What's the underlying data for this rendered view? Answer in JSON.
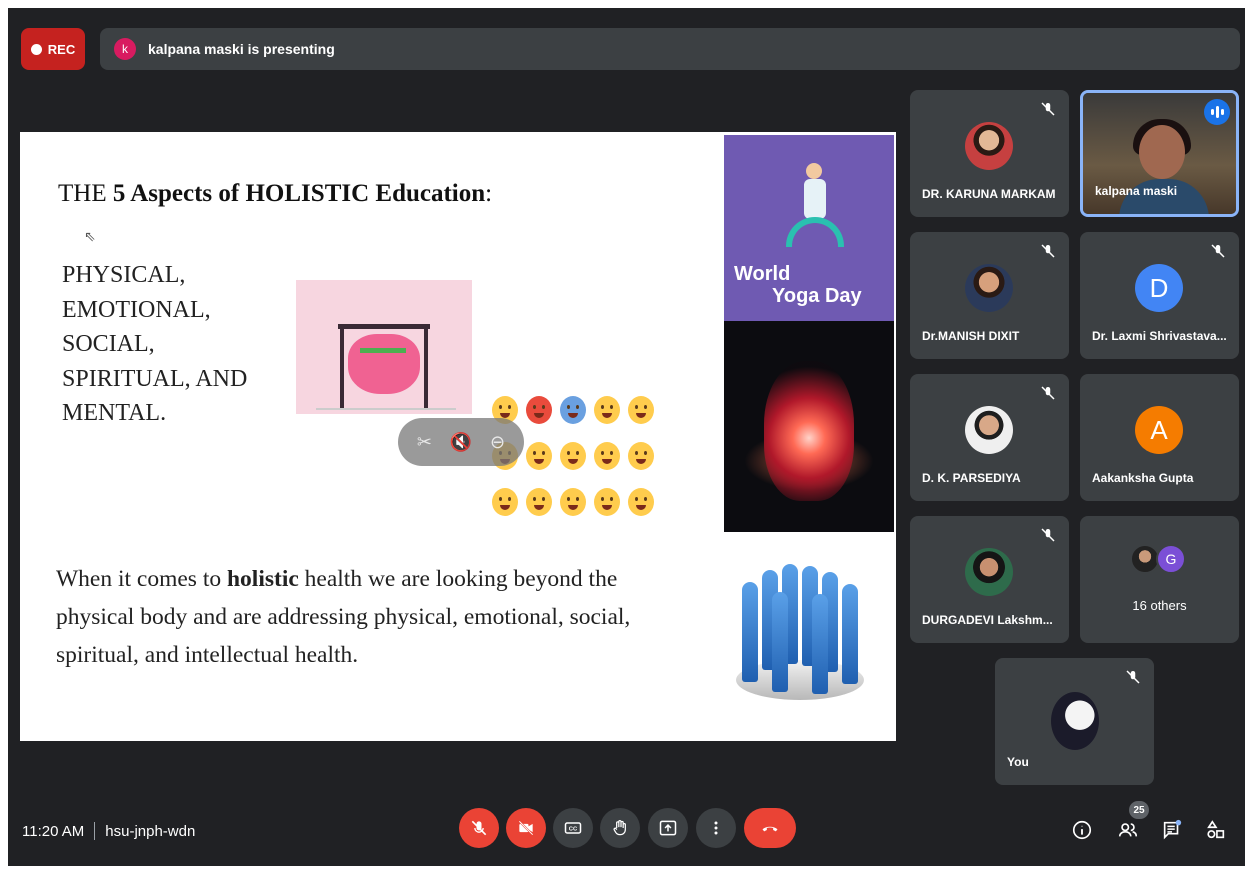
{
  "recording": {
    "label": "REC"
  },
  "presenting": {
    "avatar_letter": "k",
    "text": "kalpana maski is presenting"
  },
  "slide": {
    "title_pre": "THE ",
    "title_bold": "5 Aspects of HOLISTIC Education",
    "title_post": ":",
    "aspects": [
      "PHYSICAL,",
      "EMOTIONAL,",
      "SOCIAL,",
      "SPIRITUAL, AND",
      "MENTAL."
    ],
    "body_pre": "When it comes to ",
    "body_bold": "holistic",
    "body_post": " health we are looking beyond the physical body and are addressing physical, emotional, social, spiritual, and intellectual health.",
    "yoga_line1": "World",
    "yoga_line2": "Yoga Day"
  },
  "participants": [
    {
      "name": "DR. KARUNA MARKAM",
      "muted": true
    },
    {
      "name": "kalpana maski",
      "speaking": true
    },
    {
      "name": "Dr.MANISH DIXIT",
      "muted": true
    },
    {
      "name": "Dr. Laxmi Shrivastava...",
      "letter": "D",
      "muted": true
    },
    {
      "name": "D. K. PARSEDIYA",
      "muted": true
    },
    {
      "name": "Aakanksha Gupta",
      "letter": "A"
    },
    {
      "name": "DURGADEVI Lakshm...",
      "muted": true
    }
  ],
  "others": {
    "letter": "G",
    "label": "16 others"
  },
  "self": {
    "name": "You",
    "muted": true
  },
  "bottom": {
    "time": "11:20 AM",
    "meeting_code": "hsu-jnph-wdn",
    "people_count": "25"
  },
  "colors": {
    "background": "#202124",
    "tile": "#3c4043",
    "danger": "#ea4335",
    "accent": "#8ab4f8"
  }
}
